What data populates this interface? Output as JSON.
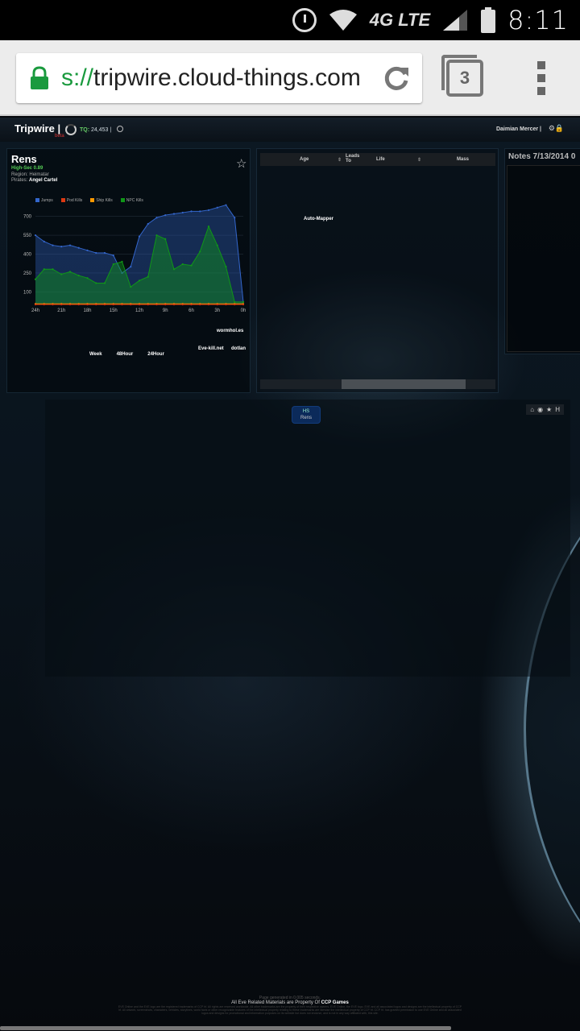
{
  "status_bar": {
    "time": "8:11",
    "network": "4G LTE",
    "icons": [
      "alarm-icon",
      "wifi-icon",
      "signal-icon",
      "battery-icon"
    ]
  },
  "browser": {
    "url_scheme": "s://",
    "url_host": "tripwire.cloud-things.com",
    "tab_count": "3"
  },
  "app": {
    "brand": "Tripwire",
    "brand_sep": "|",
    "beta_label": "beta",
    "tq_label": "TQ:",
    "tq_value": "24,453",
    "user": "Daimian Mercer"
  },
  "system": {
    "name": "Rens",
    "security": "High-Sec 0.89",
    "region_label": "Region:",
    "region": "Heimatar",
    "pirates_label": "Pirates:",
    "pirates": "Angel Cartel"
  },
  "chart_data": {
    "type": "area",
    "title": "",
    "x": [
      "24h",
      "23h",
      "22h",
      "21h",
      "20h",
      "19h",
      "18h",
      "17h",
      "16h",
      "15h",
      "14h",
      "13h",
      "12h",
      "11h",
      "10h",
      "9h",
      "8h",
      "7h",
      "6h",
      "5h",
      "4h",
      "3h",
      "2h",
      "1h",
      "0h"
    ],
    "x_ticks": [
      "24h",
      "21h",
      "18h",
      "15h",
      "12h",
      "9h",
      "6h",
      "3h",
      "0h"
    ],
    "y_ticks": [
      "700",
      "550",
      "400",
      "250",
      "100"
    ],
    "ylim": [
      0,
      800
    ],
    "legend": [
      "Jumps",
      "Pod Kills",
      "Ship Kills",
      "NPC Kills"
    ],
    "colors": {
      "Jumps": "#3366cc",
      "Pod Kills": "#dc3912",
      "Ship Kills": "#ff9900",
      "NPC Kills": "#109618"
    },
    "series": [
      {
        "name": "Jumps",
        "values": [
          550,
          500,
          470,
          460,
          470,
          450,
          430,
          410,
          410,
          390,
          250,
          300,
          540,
          640,
          690,
          710,
          720,
          730,
          740,
          740,
          750,
          770,
          790,
          690,
          20
        ]
      },
      {
        "name": "NPC Kills",
        "values": [
          200,
          280,
          280,
          240,
          260,
          230,
          210,
          170,
          170,
          320,
          340,
          140,
          190,
          220,
          550,
          520,
          280,
          320,
          310,
          420,
          620,
          470,
          300,
          20,
          20
        ]
      },
      {
        "name": "Ship Kills",
        "values": [
          5,
          5,
          5,
          5,
          5,
          5,
          5,
          5,
          5,
          5,
          5,
          5,
          5,
          5,
          5,
          5,
          5,
          5,
          5,
          5,
          5,
          5,
          5,
          5,
          5
        ]
      },
      {
        "name": "Pod Kills",
        "values": [
          0,
          0,
          0,
          0,
          0,
          0,
          0,
          0,
          0,
          0,
          0,
          0,
          0,
          0,
          0,
          0,
          0,
          0,
          0,
          0,
          0,
          0,
          0,
          0,
          0
        ]
      }
    ]
  },
  "chart_links": {
    "week": "Week",
    "h48": "48Hour",
    "h24": "24Hour",
    "wormholes": "wormhol.es",
    "evekill": "Eve-kill.net",
    "dotlan": "dotlan"
  },
  "signatures": {
    "columns": [
      "Age",
      "Leads To",
      "Life",
      "Mass"
    ],
    "automapper": "Auto-Mapper"
  },
  "notes": {
    "title": "Notes 7/13/2014 0"
  },
  "map": {
    "node_class": "HS",
    "node_name": "Rens",
    "tool_label": "H"
  },
  "footer": {
    "generated": "Page generated in 0.005 seconds.",
    "property_prefix": "All Eve Related Materials are Property Of",
    "property_owner": "CCP Games",
    "legal": "EVE Online and the EVE logo are the registered trademarks of CCP hf. All rights are reserved worldwide. All other trademarks are the property of their respective owners. EVE Online, the EVE logo, EVE and all associated logos and designs are the intellectual property of CCP hf. All artwork, screenshots, characters, vehicles, storylines, world facts or other recognizable features of the intellectual property relating to these trademarks are likewise the intellectual property of CCP hf. CCP hf. has granted permission to use EVE Online and all associated logos and designs for promotional and information purposes on its website but does not endorse, and is not in any way affiliated with, this site."
  }
}
